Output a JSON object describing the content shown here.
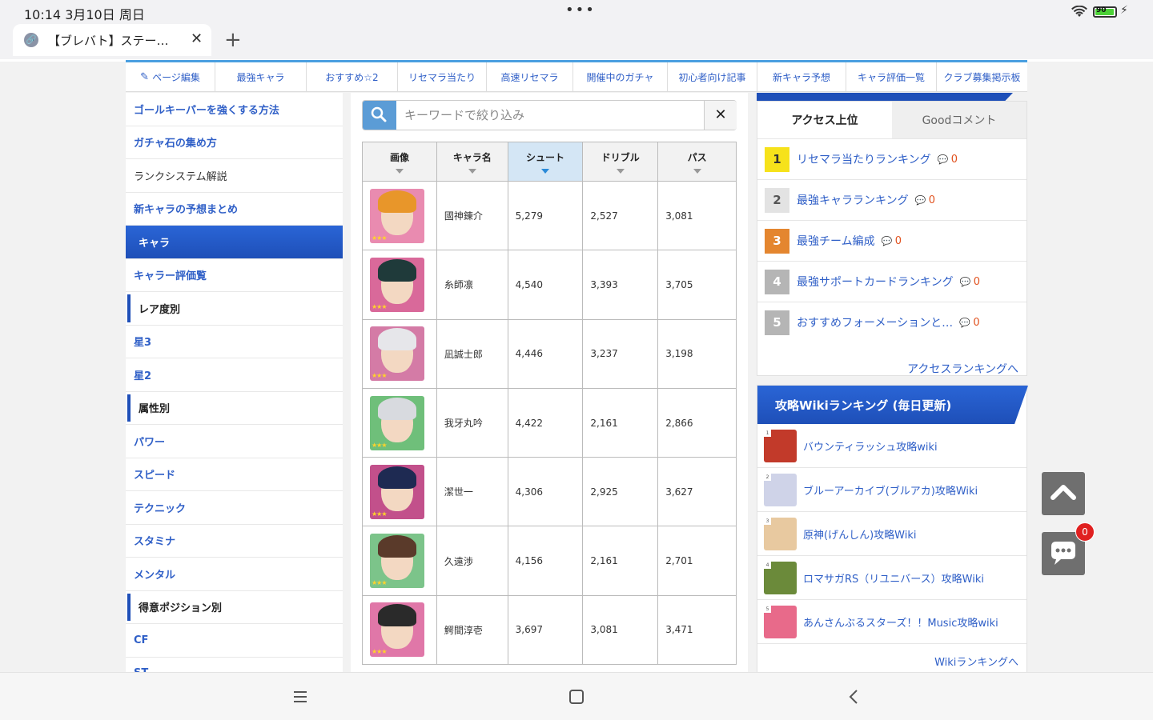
{
  "status": {
    "time": "10:14  3月10日 周日",
    "menu_dots": "•••",
    "battery": "90",
    "bolt_icon": "⚡"
  },
  "browser": {
    "tab_title": "【ブレバト】ステー…",
    "close": "✕",
    "new_tab": "+"
  },
  "topnav": [
    {
      "label": "ページ編集",
      "icon": "pencil-icon"
    },
    {
      "label": "最強キャラ"
    },
    {
      "label": "おすすめ☆2"
    },
    {
      "label": "リセマラ当たり"
    },
    {
      "label": "高速リセマラ"
    },
    {
      "label": "開催中のガチャ"
    },
    {
      "label": "初心者向け記事"
    },
    {
      "label": "新キャラ予想"
    },
    {
      "label": "キャラ評価一覧"
    },
    {
      "label": "クラブ募集掲示板"
    }
  ],
  "leftnav": [
    {
      "label": "ゴールキーパーを強くする方法",
      "style": "link"
    },
    {
      "label": "ガチャ石の集め方",
      "style": "link"
    },
    {
      "label": "ランクシステム解説",
      "style": "plain"
    },
    {
      "label": "新キャラの予想まとめ",
      "style": "link"
    },
    {
      "label": "キャラ",
      "style": "active"
    },
    {
      "label": "キャラー評価覧",
      "style": "link"
    },
    {
      "label": "レア度別",
      "style": "head"
    },
    {
      "label": "星3",
      "style": "link"
    },
    {
      "label": "星2",
      "style": "link"
    },
    {
      "label": "属性別",
      "style": "head"
    },
    {
      "label": "パワー",
      "style": "link"
    },
    {
      "label": "スピード",
      "style": "link"
    },
    {
      "label": "テクニック",
      "style": "link"
    },
    {
      "label": "スタミナ",
      "style": "link"
    },
    {
      "label": "メンタル",
      "style": "link"
    },
    {
      "label": "得意ポジション別",
      "style": "head"
    },
    {
      "label": "CF",
      "style": "link"
    },
    {
      "label": "ST",
      "style": "link"
    }
  ],
  "search": {
    "placeholder": "キーワードで絞り込み",
    "clear": "✕"
  },
  "table": {
    "headers": [
      "画像",
      "キャラ名",
      "シュート",
      "ドリブル",
      "パス"
    ],
    "sorted_column": 2,
    "rows": [
      {
        "name": "國神錬介",
        "shoot": "5,279",
        "dribble": "2,527",
        "pass": "3,081",
        "bg": "#e98bb0",
        "hair": "#e8962a"
      },
      {
        "name": "糸師凛",
        "shoot": "4,540",
        "dribble": "3,393",
        "pass": "3,705",
        "bg": "#d9699a",
        "hair": "#1f3a3a"
      },
      {
        "name": "凪誠士郎",
        "shoot": "4,446",
        "dribble": "3,237",
        "pass": "3,198",
        "bg": "#d47ba6",
        "hair": "#e6e6ea"
      },
      {
        "name": "我牙丸吟",
        "shoot": "4,422",
        "dribble": "2,161",
        "pass": "2,866",
        "bg": "#6fbf7a",
        "hair": "#d8dadf"
      },
      {
        "name": "潔世一",
        "shoot": "4,306",
        "dribble": "2,925",
        "pass": "3,627",
        "bg": "#c2508b",
        "hair": "#1e2a52"
      },
      {
        "name": "久遠渉",
        "shoot": "4,156",
        "dribble": "2,161",
        "pass": "2,701",
        "bg": "#7cc48a",
        "hair": "#5a3a2a"
      },
      {
        "name": "鰐間淳壱",
        "shoot": "3,697",
        "dribble": "3,081",
        "pass": "3,471",
        "bg": "#e077a8",
        "hair": "#2a2a2a"
      }
    ]
  },
  "ranking": {
    "tabs": [
      "アクセス上位",
      "Goodコメント"
    ],
    "items": [
      {
        "rank": "1",
        "label": "リセマラ当たりランキング",
        "comments": "0",
        "color": "#f6e21b",
        "text": "#333"
      },
      {
        "rank": "2",
        "label": "最強キャラランキング",
        "comments": "0",
        "color": "#e3e3e3",
        "text": "#555"
      },
      {
        "rank": "3",
        "label": "最強チーム編成",
        "comments": "0",
        "color": "#e4862f",
        "text": "#fff"
      },
      {
        "rank": "4",
        "label": "最強サポートカードランキング",
        "comments": "0",
        "color": "#b5b5b5",
        "text": "#fff"
      },
      {
        "rank": "5",
        "label": "おすすめフォーメーションと…",
        "comments": "0",
        "color": "#b5b5b5",
        "text": "#fff"
      }
    ],
    "more": "アクセスランキングへ"
  },
  "wiki": {
    "title": "攻略Wikiランキング (毎日更新)",
    "items": [
      {
        "n": "1",
        "label": "バウンティラッシュ攻略wiki",
        "color": "#c23a2a"
      },
      {
        "n": "2",
        "label": "ブルーアーカイブ(ブルアカ)攻略Wiki",
        "color": "#cfd3e8"
      },
      {
        "n": "3",
        "label": "原神(げんしん)攻略Wiki",
        "color": "#e8c9a0"
      },
      {
        "n": "4",
        "label": "ロマサガRS（リユニバース）攻略Wiki",
        "color": "#6b8a3a"
      },
      {
        "n": "5",
        "label": "あんさんぶるスターズ！！Music攻略wiki",
        "color": "#e86a8a"
      }
    ],
    "more": "Wikiランキングへ"
  },
  "floating": {
    "chat_badge": "0"
  }
}
